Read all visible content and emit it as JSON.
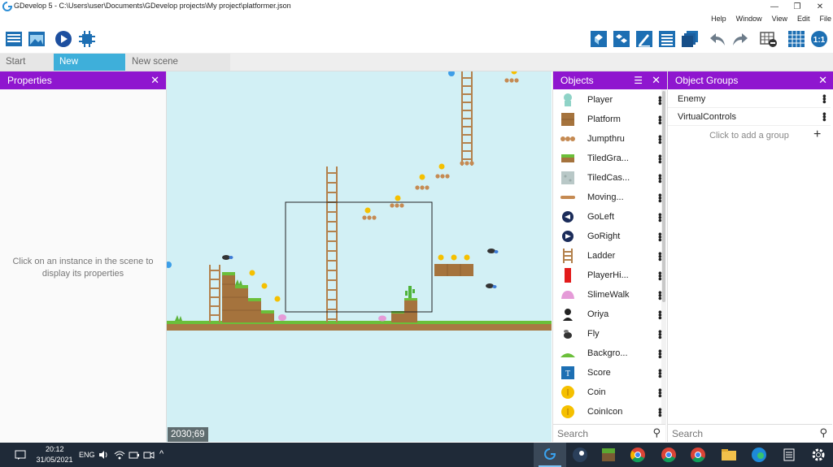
{
  "window": {
    "title": "GDevelop 5 - C:\\Users\\user\\Documents\\GDevelop projects\\My project\\platformer.json",
    "minimize_glyph": "—",
    "maximize_glyph": "❐",
    "close_glyph": "✕"
  },
  "menu": [
    "Help",
    "Window",
    "View",
    "Edit",
    "File"
  ],
  "toolbar": {
    "left_icons": [
      "project-manager-icon",
      "scene-editor-icon",
      "preview-play-icon",
      "debugger-icon"
    ],
    "right_icons": [
      "open-objects-icon",
      "object-groups-icon",
      "properties-icon",
      "layers-icon",
      "instances-list-icon",
      "undo-icon",
      "redo-icon",
      "grid-settings-icon",
      "toggle-grid-icon",
      "zoom-reset-icon"
    ]
  },
  "tabs": [
    {
      "label": "Start Page",
      "active": false,
      "closable": false
    },
    {
      "label": "New scene",
      "active": true,
      "closable": true
    },
    {
      "label": "New scene (Events)",
      "active": false,
      "closable": true
    }
  ],
  "properties": {
    "title": "Properties",
    "hint": "Click on an instance in the scene to display its properties"
  },
  "scene": {
    "coordinates": "2030;69"
  },
  "objects": {
    "title": "Objects",
    "items": [
      {
        "name": "Player",
        "icon": "player-icon"
      },
      {
        "name": "Platform",
        "icon": "dirt-block-icon"
      },
      {
        "name": "Jumpthru",
        "icon": "jumpthru-icon"
      },
      {
        "name": "TiledGra...",
        "icon": "grass-tile-icon"
      },
      {
        "name": "TiledCas...",
        "icon": "castle-tile-icon"
      },
      {
        "name": "Moving...",
        "icon": "moving-platform-icon"
      },
      {
        "name": "GoLeft",
        "icon": "go-left-icon"
      },
      {
        "name": "GoRight",
        "icon": "go-right-icon"
      },
      {
        "name": "Ladder",
        "icon": "ladder-icon"
      },
      {
        "name": "PlayerHi...",
        "icon": "player-hitbox-icon"
      },
      {
        "name": "SlimeWalk",
        "icon": "slime-icon"
      },
      {
        "name": "Oriya",
        "icon": "oriya-icon"
      },
      {
        "name": "Fly",
        "icon": "fly-icon"
      },
      {
        "name": "Backgro...",
        "icon": "background-icon"
      },
      {
        "name": "Score",
        "icon": "text-object-icon"
      },
      {
        "name": "Coin",
        "icon": "coin-icon"
      },
      {
        "name": "CoinIcon",
        "icon": "coin-icon"
      }
    ],
    "search_placeholder": "Search"
  },
  "groups": {
    "title": "Object Groups",
    "items": [
      "Enemy",
      "VirtualControls"
    ],
    "add_label": "Click to add a group",
    "search_placeholder": "Search"
  },
  "taskbar": {
    "time": "20:12",
    "date": "31/05/2021",
    "language": "ENG"
  },
  "colors": {
    "panel_header": "#8f16cf",
    "active_tab": "#3eafda",
    "scene_background": "#d2f0f5",
    "taskbar": "#1f2a38"
  }
}
